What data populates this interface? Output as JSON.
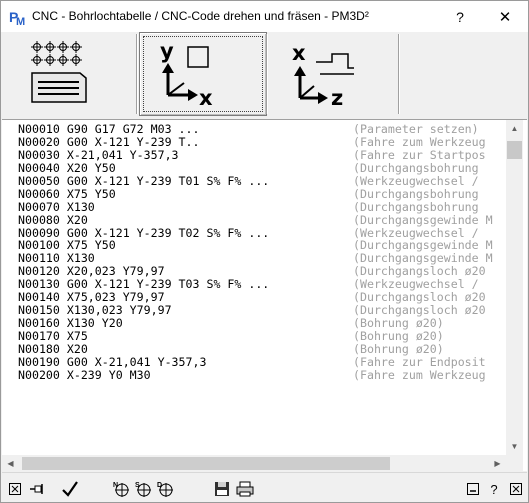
{
  "window": {
    "title": "CNC - Bohrlochtabelle / CNC-Code drehen und fräsen   -   PM3D²",
    "help_label": "?",
    "close_label": "✕"
  },
  "toolbar": {
    "buttons": [
      {
        "name": "hole-table",
        "state": "normal"
      },
      {
        "name": "drill-xy",
        "state": "active",
        "labels": {
          "y": "y",
          "x": "x"
        }
      },
      {
        "name": "turn-xz",
        "state": "normal",
        "labels": {
          "x": "x",
          "z": "z"
        }
      }
    ]
  },
  "code": {
    "lines": [
      {
        "cmd": "N00010 G90 G17 G72 M03 ...",
        "comment": "(Parameter setzen)"
      },
      {
        "cmd": "N00020 G00 X-121 Y-239 T..",
        "comment": "(Fahre zum Werkzeug"
      },
      {
        "cmd": "N00030 X-21,041 Y-357,3",
        "comment": "(Fahre zur Startpos"
      },
      {
        "cmd": "N00040 X20 Y50",
        "comment": "(Durchgangsbohrung"
      },
      {
        "cmd": "N00050 G00 X-121 Y-239 T01 S% F% ...",
        "comment": "(Werkzeugwechsel /"
      },
      {
        "cmd": "N00060 X75 Y50",
        "comment": "(Durchgangsbohrung"
      },
      {
        "cmd": "N00070 X130",
        "comment": "(Durchgangsbohrung"
      },
      {
        "cmd": "N00080 X20",
        "comment": "(Durchgangsgewinde M"
      },
      {
        "cmd": "N00090 G00 X-121 Y-239 T02 S% F% ...",
        "comment": "(Werkzeugwechsel /"
      },
      {
        "cmd": "N00100 X75 Y50",
        "comment": "(Durchgangsgewinde M"
      },
      {
        "cmd": "N00110 X130",
        "comment": "(Durchgangsgewinde M"
      },
      {
        "cmd": "N00120 X20,023 Y79,97",
        "comment": "(Durchgangsloch ø20"
      },
      {
        "cmd": "N00130 G00 X-121 Y-239 T03 S% F% ...",
        "comment": "(Werkzeugwechsel /"
      },
      {
        "cmd": "N00140 X75,023 Y79,97",
        "comment": "(Durchgangsloch ø20"
      },
      {
        "cmd": "N00150 X130,023 Y79,97",
        "comment": "(Durchgangsloch ø20"
      },
      {
        "cmd": "N00160 X130 Y20",
        "comment": "(Bohrung ø20)"
      },
      {
        "cmd": "N00170 X75",
        "comment": "(Bohrung ø20)"
      },
      {
        "cmd": "N00180 X20",
        "comment": "(Bohrung ø20)"
      },
      {
        "cmd": "N00190 G00 X-21,041 Y-357,3",
        "comment": "(Fahre zur Endposit"
      },
      {
        "cmd": "N00200 X-239 Y0 M30",
        "comment": "(Fahre zum Werkzeug"
      }
    ]
  },
  "bottombar": {
    "icons": [
      "close-box-icon",
      "pin-icon",
      "checkmark-icon",
      "n-compass-icon",
      "s-compass-icon",
      "d-compass-icon",
      "save-icon",
      "print-icon",
      "minimize-icon",
      "help-icon",
      "settings-icon"
    ],
    "help_label": "?"
  }
}
